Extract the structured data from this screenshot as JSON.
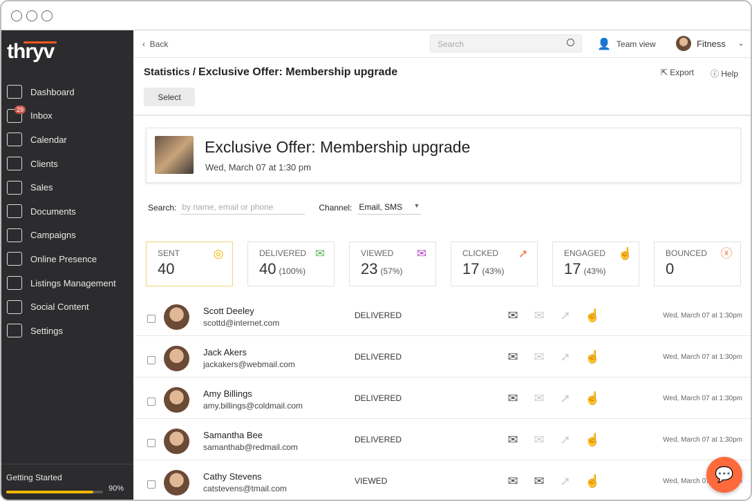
{
  "app": {
    "logo": "thryv",
    "accent": "#ff5a1f"
  },
  "sidebar": {
    "items": [
      {
        "label": "Dashboard",
        "icon": "dashboard-icon"
      },
      {
        "label": "Inbox",
        "icon": "inbox-icon",
        "badge": "29"
      },
      {
        "label": "Calendar",
        "icon": "calendar-icon"
      },
      {
        "label": "Clients",
        "icon": "clients-icon"
      },
      {
        "label": "Sales",
        "icon": "sales-icon"
      },
      {
        "label": "Documents",
        "icon": "documents-icon"
      },
      {
        "label": "Campaigns",
        "icon": "campaigns-icon"
      },
      {
        "label": "Online Presence",
        "icon": "globe-icon"
      },
      {
        "label": "Listings Management",
        "icon": "listings-icon"
      },
      {
        "label": "Social Content",
        "icon": "social-icon"
      },
      {
        "label": "Settings",
        "icon": "gear-icon"
      }
    ],
    "getting_started": {
      "label": "Getting Started",
      "progress_percent": 90,
      "progress_text": "90%"
    }
  },
  "topbar": {
    "back": "Back",
    "search_placeholder": "Search",
    "team_view": "Team view",
    "account": "Fitness"
  },
  "header": {
    "breadcrumb": "Statistics /",
    "title": "Exclusive Offer: Membership upgrade",
    "export": "Export",
    "help": "Help",
    "select": "Select"
  },
  "campaign": {
    "title": "Exclusive Offer: Membership upgrade",
    "date": "Wed, March 07 at 1:30 pm"
  },
  "filters": {
    "search_label": "Search:",
    "search_placeholder": "by name, email or phone",
    "channel_label": "Channel:",
    "channel_value": "Email, SMS"
  },
  "stats": [
    {
      "label": "SENT",
      "value": "40",
      "pct": "",
      "icon": "target-icon",
      "color": "#f2b705"
    },
    {
      "label": "DELIVERED",
      "value": "40",
      "pct": "(100%)",
      "icon": "envelope-icon",
      "color": "#5cb85c"
    },
    {
      "label": "VIEWED",
      "value": "23",
      "pct": "(57%)",
      "icon": "open-envelope-icon",
      "color": "#b44fc8"
    },
    {
      "label": "CLICKED",
      "value": "17",
      "pct": "(43%)",
      "icon": "cursor-click-icon",
      "color": "#f07b3f"
    },
    {
      "label": "ENGAGED",
      "value": "17",
      "pct": "(43%)",
      "icon": "hand-tap-icon",
      "color": "#1aa58a"
    },
    {
      "label": "BOUNCED",
      "value": "0",
      "pct": "",
      "icon": "x-circle-icon",
      "color": "#f07b3f"
    }
  ],
  "recipients": [
    {
      "name": "Scott Deeley",
      "email": "scottd@internet.com",
      "status": "DELIVERED",
      "viewed": false,
      "time": "Wed, March 07 at 1:30pm"
    },
    {
      "name": "Jack Akers",
      "email": "jackakers@webmail.com",
      "status": "DELIVERED",
      "viewed": false,
      "time": "Wed, March 07 at 1:30pm"
    },
    {
      "name": "Amy Billings",
      "email": "amy.billings@coldmail.com",
      "status": "DELIVERED",
      "viewed": false,
      "time": "Wed, March 07 at 1:30pm"
    },
    {
      "name": "Samantha Bee",
      "email": "samanthab@redmail.com",
      "status": "DELIVERED",
      "viewed": false,
      "time": "Wed, March 07 at 1:30pm"
    },
    {
      "name": "Cathy Stevens",
      "email": "catstevens@tmail.com",
      "status": "VIEWED",
      "viewed": true,
      "time": "Wed, March 07 at 1:30pm"
    }
  ]
}
